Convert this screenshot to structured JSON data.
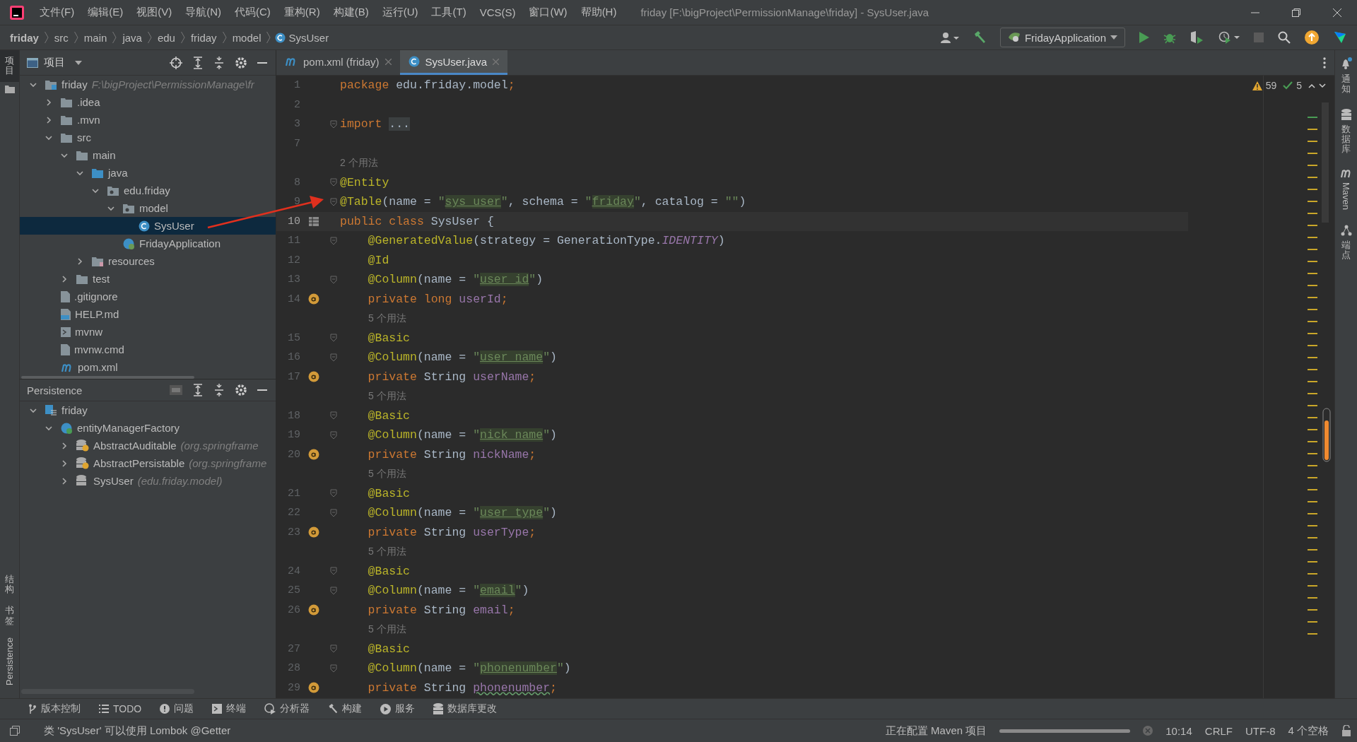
{
  "menu": [
    "文件(F)",
    "编辑(E)",
    "视图(V)",
    "导航(N)",
    "代码(C)",
    "重构(R)",
    "构建(B)",
    "运行(U)",
    "工具(T)",
    "VCS(S)",
    "窗口(W)",
    "帮助(H)"
  ],
  "window_title": "friday [F:\\bigProject\\PermissionManage\\friday] - SysUser.java",
  "breadcrumb": [
    "friday",
    "src",
    "main",
    "java",
    "edu",
    "friday",
    "model",
    "SysUser"
  ],
  "run_config": "FridayApplication",
  "project_panel": {
    "title": "项目",
    "tree": [
      {
        "label": "friday",
        "hint": "F:\\bigProject\\PermissionManage\\fr",
        "kind": "module",
        "selected": false,
        "expanded": true,
        "children": [
          {
            "label": ".idea",
            "kind": "folder",
            "selected": false,
            "expanded": false
          },
          {
            "label": ".mvn",
            "kind": "folder",
            "selected": false,
            "expanded": false
          },
          {
            "label": "src",
            "kind": "folder",
            "selected": false,
            "expanded": true,
            "children": [
              {
                "label": "main",
                "kind": "folder",
                "selected": false,
                "expanded": true,
                "children": [
                  {
                    "label": "java",
                    "kind": "source",
                    "selected": false,
                    "expanded": true,
                    "children": [
                      {
                        "label": "edu.friday",
                        "kind": "package",
                        "selected": false,
                        "expanded": true,
                        "children": [
                          {
                            "label": "model",
                            "kind": "package",
                            "selected": false,
                            "expanded": true,
                            "children": [
                              {
                                "label": "SysUser",
                                "kind": "class",
                                "selected": true
                              }
                            ]
                          },
                          {
                            "label": "FridayApplication",
                            "kind": "spring",
                            "selected": false
                          }
                        ]
                      }
                    ]
                  },
                  {
                    "label": "resources",
                    "kind": "resources",
                    "selected": false,
                    "expanded": false
                  }
                ]
              },
              {
                "label": "test",
                "kind": "folder",
                "selected": false,
                "expanded": false
              }
            ]
          },
          {
            "label": ".gitignore",
            "kind": "file",
            "selected": false
          },
          {
            "label": "HELP.md",
            "kind": "markdown",
            "selected": false
          },
          {
            "label": "mvnw",
            "kind": "script",
            "selected": false
          },
          {
            "label": "mvnw.cmd",
            "kind": "file",
            "selected": false
          },
          {
            "label": "pom.xml",
            "kind": "maven",
            "selected": false
          }
        ]
      }
    ]
  },
  "persistence": {
    "title": "Persistence",
    "tree": [
      {
        "label": "friday",
        "kind": "unit",
        "selected": false,
        "expanded": true,
        "children": [
          {
            "label": "entityManagerFactory",
            "kind": "factory",
            "selected": false,
            "expanded": true,
            "children": [
              {
                "label": "AbstractAuditable",
                "hint": "(org.springframe",
                "kind": "abstract",
                "selected": false,
                "expanded": false
              },
              {
                "label": "AbstractPersistable",
                "hint": "(org.springframe",
                "kind": "abstract",
                "selected": false,
                "expanded": false
              },
              {
                "label": "SysUser",
                "hint": "(edu.friday.model)",
                "kind": "entity",
                "selected": false,
                "expanded": false
              }
            ]
          }
        ]
      }
    ]
  },
  "tabs": [
    {
      "label": "pom.xml (friday)",
      "kind": "maven",
      "selected": false
    },
    {
      "label": "SysUser.java",
      "kind": "class",
      "selected": true
    }
  ],
  "inspections": {
    "warnings": "59",
    "passed": "5"
  },
  "code": [
    {
      "kind": "line",
      "num": "1",
      "current": false,
      "tokens": [
        {
          "kind": "keyword",
          "text": "package "
        },
        {
          "kind": "plain",
          "text": "edu.friday.model"
        },
        {
          "kind": "keyword",
          "text": ";"
        }
      ]
    },
    {
      "kind": "line",
      "num": "2",
      "current": false
    },
    {
      "kind": "line",
      "num": "3",
      "current": false,
      "foldable": true,
      "tokens": [
        {
          "kind": "keyword",
          "text": "import "
        },
        {
          "kind": "folded",
          "text": "..."
        }
      ]
    },
    {
      "kind": "line",
      "num": "7",
      "current": false
    },
    {
      "kind": "usage",
      "indented": false,
      "text": "2 个用法"
    },
    {
      "kind": "line",
      "num": "8",
      "current": false,
      "foldable": true,
      "tokens": [
        {
          "kind": "annotation",
          "text": "@Entity"
        }
      ]
    },
    {
      "kind": "line",
      "num": "9",
      "current": false,
      "foldable": true,
      "tokens": [
        {
          "kind": "annotation",
          "text": "@Table"
        },
        {
          "kind": "plain",
          "text": "(name = "
        },
        {
          "kind": "string",
          "text": "\""
        },
        {
          "kind": "sql",
          "text": "sys_user"
        },
        {
          "kind": "string",
          "text": "\""
        },
        {
          "kind": "plain",
          "text": ", schema = "
        },
        {
          "kind": "string",
          "text": "\""
        },
        {
          "kind": "sql",
          "text": "friday"
        },
        {
          "kind": "string",
          "text": "\""
        },
        {
          "kind": "plain",
          "text": ", catalog = "
        },
        {
          "kind": "string",
          "text": "\"\""
        },
        {
          "kind": "plain",
          "text": ")"
        }
      ]
    },
    {
      "kind": "class-line",
      "num": "10",
      "current": true,
      "tokens": [
        {
          "kind": "keyword",
          "text": "public class "
        },
        {
          "kind": "plain",
          "text": "SysUser {"
        }
      ]
    },
    {
      "kind": "line",
      "num": "11",
      "current": false,
      "foldable": true,
      "indented": true,
      "tokens": [
        {
          "kind": "annotation",
          "text": "@GeneratedValue"
        },
        {
          "kind": "plain",
          "text": "(strategy = GenerationType."
        },
        {
          "kind": "static",
          "text": "IDENTITY"
        },
        {
          "kind": "plain",
          "text": ")"
        }
      ]
    },
    {
      "kind": "line",
      "num": "12",
      "current": false,
      "indented": true,
      "tokens": [
        {
          "kind": "annotation",
          "text": "@Id"
        }
      ]
    },
    {
      "kind": "line",
      "num": "13",
      "current": false,
      "foldable": true,
      "indented": true,
      "tokens": [
        {
          "kind": "annotation",
          "text": "@Column"
        },
        {
          "kind": "plain",
          "text": "(name = "
        },
        {
          "kind": "string",
          "text": "\""
        },
        {
          "kind": "sql",
          "text": "user_id"
        },
        {
          "kind": "string",
          "text": "\""
        },
        {
          "kind": "plain",
          "text": ")"
        }
      ]
    },
    {
      "kind": "field-line",
      "num": "14",
      "current": false,
      "indented": true,
      "tokens": [
        {
          "kind": "keyword",
          "text": "private long "
        },
        {
          "kind": "field",
          "text": "userId"
        },
        {
          "kind": "keyword",
          "text": ";"
        }
      ]
    },
    {
      "kind": "usage",
      "indented": true,
      "text": "5 个用法"
    },
    {
      "kind": "line",
      "num": "15",
      "current": false,
      "foldable": true,
      "indented": true,
      "tokens": [
        {
          "kind": "annotation",
          "text": "@Basic"
        }
      ]
    },
    {
      "kind": "line",
      "num": "16",
      "current": false,
      "foldable": true,
      "indented": true,
      "tokens": [
        {
          "kind": "annotation",
          "text": "@Column"
        },
        {
          "kind": "plain",
          "text": "(name = "
        },
        {
          "kind": "string",
          "text": "\""
        },
        {
          "kind": "sql",
          "text": "user_name"
        },
        {
          "kind": "string",
          "text": "\""
        },
        {
          "kind": "plain",
          "text": ")"
        }
      ]
    },
    {
      "kind": "field-line",
      "num": "17",
      "current": false,
      "indented": true,
      "tokens": [
        {
          "kind": "keyword",
          "text": "private "
        },
        {
          "kind": "plain",
          "text": "String "
        },
        {
          "kind": "field",
          "text": "userName"
        },
        {
          "kind": "keyword",
          "text": ";"
        }
      ]
    },
    {
      "kind": "usage",
      "indented": true,
      "text": "5 个用法"
    },
    {
      "kind": "line",
      "num": "18",
      "current": false,
      "foldable": true,
      "indented": true,
      "tokens": [
        {
          "kind": "annotation",
          "text": "@Basic"
        }
      ]
    },
    {
      "kind": "line",
      "num": "19",
      "current": false,
      "foldable": true,
      "indented": true,
      "tokens": [
        {
          "kind": "annotation",
          "text": "@Column"
        },
        {
          "kind": "plain",
          "text": "(name = "
        },
        {
          "kind": "string",
          "text": "\""
        },
        {
          "kind": "sql",
          "text": "nick_name"
        },
        {
          "kind": "string",
          "text": "\""
        },
        {
          "kind": "plain",
          "text": ")"
        }
      ]
    },
    {
      "kind": "field-line",
      "num": "20",
      "current": false,
      "indented": true,
      "tokens": [
        {
          "kind": "keyword",
          "text": "private "
        },
        {
          "kind": "plain",
          "text": "String "
        },
        {
          "kind": "field",
          "text": "nickName"
        },
        {
          "kind": "keyword",
          "text": ";"
        }
      ]
    },
    {
      "kind": "usage",
      "indented": true,
      "text": "5 个用法"
    },
    {
      "kind": "line",
      "num": "21",
      "current": false,
      "foldable": true,
      "indented": true,
      "tokens": [
        {
          "kind": "annotation",
          "text": "@Basic"
        }
      ]
    },
    {
      "kind": "line",
      "num": "22",
      "current": false,
      "foldable": true,
      "indented": true,
      "tokens": [
        {
          "kind": "annotation",
          "text": "@Column"
        },
        {
          "kind": "plain",
          "text": "(name = "
        },
        {
          "kind": "string",
          "text": "\""
        },
        {
          "kind": "sql",
          "text": "user_type"
        },
        {
          "kind": "string",
          "text": "\""
        },
        {
          "kind": "plain",
          "text": ")"
        }
      ]
    },
    {
      "kind": "field-line",
      "num": "23",
      "current": false,
      "indented": true,
      "tokens": [
        {
          "kind": "keyword",
          "text": "private "
        },
        {
          "kind": "plain",
          "text": "String "
        },
        {
          "kind": "field",
          "text": "userType"
        },
        {
          "kind": "keyword",
          "text": ";"
        }
      ]
    },
    {
      "kind": "usage",
      "indented": true,
      "text": "5 个用法"
    },
    {
      "kind": "line",
      "num": "24",
      "current": false,
      "foldable": true,
      "indented": true,
      "tokens": [
        {
          "kind": "annotation",
          "text": "@Basic"
        }
      ]
    },
    {
      "kind": "line",
      "num": "25",
      "current": false,
      "foldable": true,
      "indented": true,
      "tokens": [
        {
          "kind": "annotation",
          "text": "@Column"
        },
        {
          "kind": "plain",
          "text": "(name = "
        },
        {
          "kind": "string",
          "text": "\""
        },
        {
          "kind": "sql",
          "text": "email"
        },
        {
          "kind": "string",
          "text": "\""
        },
        {
          "kind": "plain",
          "text": ")"
        }
      ]
    },
    {
      "kind": "field-line",
      "num": "26",
      "current": false,
      "indented": true,
      "tokens": [
        {
          "kind": "keyword",
          "text": "private "
        },
        {
          "kind": "plain",
          "text": "String "
        },
        {
          "kind": "field",
          "text": "email"
        },
        {
          "kind": "keyword",
          "text": ";"
        }
      ]
    },
    {
      "kind": "usage",
      "indented": true,
      "text": "5 个用法"
    },
    {
      "kind": "line",
      "num": "27",
      "current": false,
      "foldable": true,
      "indented": true,
      "tokens": [
        {
          "kind": "annotation",
          "text": "@Basic"
        }
      ]
    },
    {
      "kind": "line",
      "num": "28",
      "current": false,
      "foldable": true,
      "indented": true,
      "tokens": [
        {
          "kind": "annotation",
          "text": "@Column"
        },
        {
          "kind": "plain",
          "text": "(name = "
        },
        {
          "kind": "string",
          "text": "\""
        },
        {
          "kind": "sql",
          "text": "phonenumber"
        },
        {
          "kind": "string",
          "text": "\""
        },
        {
          "kind": "plain",
          "text": ")"
        }
      ]
    },
    {
      "kind": "field-line",
      "num": "29",
      "current": false,
      "indented": true,
      "tokens": [
        {
          "kind": "keyword",
          "text": "private "
        },
        {
          "kind": "plain",
          "text": "String "
        },
        {
          "kind": "typo",
          "text": "phonenumber"
        },
        {
          "kind": "keyword",
          "text": ";"
        }
      ]
    }
  ],
  "left_stripe": {
    "top": [
      {
        "label": "项目",
        "kind": "cjk",
        "selected": true
      }
    ],
    "bottom": [
      {
        "label": "结构",
        "kind": "cjk",
        "selected": false
      },
      {
        "label": "书签",
        "kind": "cjk",
        "selected": false
      },
      {
        "label": "Persistence",
        "kind": "latin",
        "selected": false
      }
    ]
  },
  "right_stripe": [
    {
      "label": "通知",
      "kind": "cjk"
    },
    {
      "label": "数据库",
      "kind": "cjk"
    },
    {
      "label": "Maven",
      "kind": "latin"
    },
    {
      "label": "端点",
      "kind": "cjk"
    }
  ],
  "tool_buttons": [
    {
      "label": "版本控制",
      "kind": "vcs"
    },
    {
      "label": "TODO",
      "kind": "list"
    },
    {
      "label": "问题",
      "kind": "problem"
    },
    {
      "label": "终端",
      "kind": "terminal"
    },
    {
      "label": "分析器",
      "kind": "profiler"
    },
    {
      "label": "构建",
      "kind": "build"
    },
    {
      "label": "服务",
      "kind": "services"
    },
    {
      "label": "数据库更改",
      "kind": "database"
    }
  ],
  "status": {
    "message": "类 'SysUser' 可以使用 Lombok @Getter",
    "task": "正在配置 Maven 项目",
    "task_progress": {
      "level": 1
    },
    "position": "10:14",
    "line_separator": "CRLF",
    "encoding": "UTF-8",
    "indent": "4 个空格"
  }
}
